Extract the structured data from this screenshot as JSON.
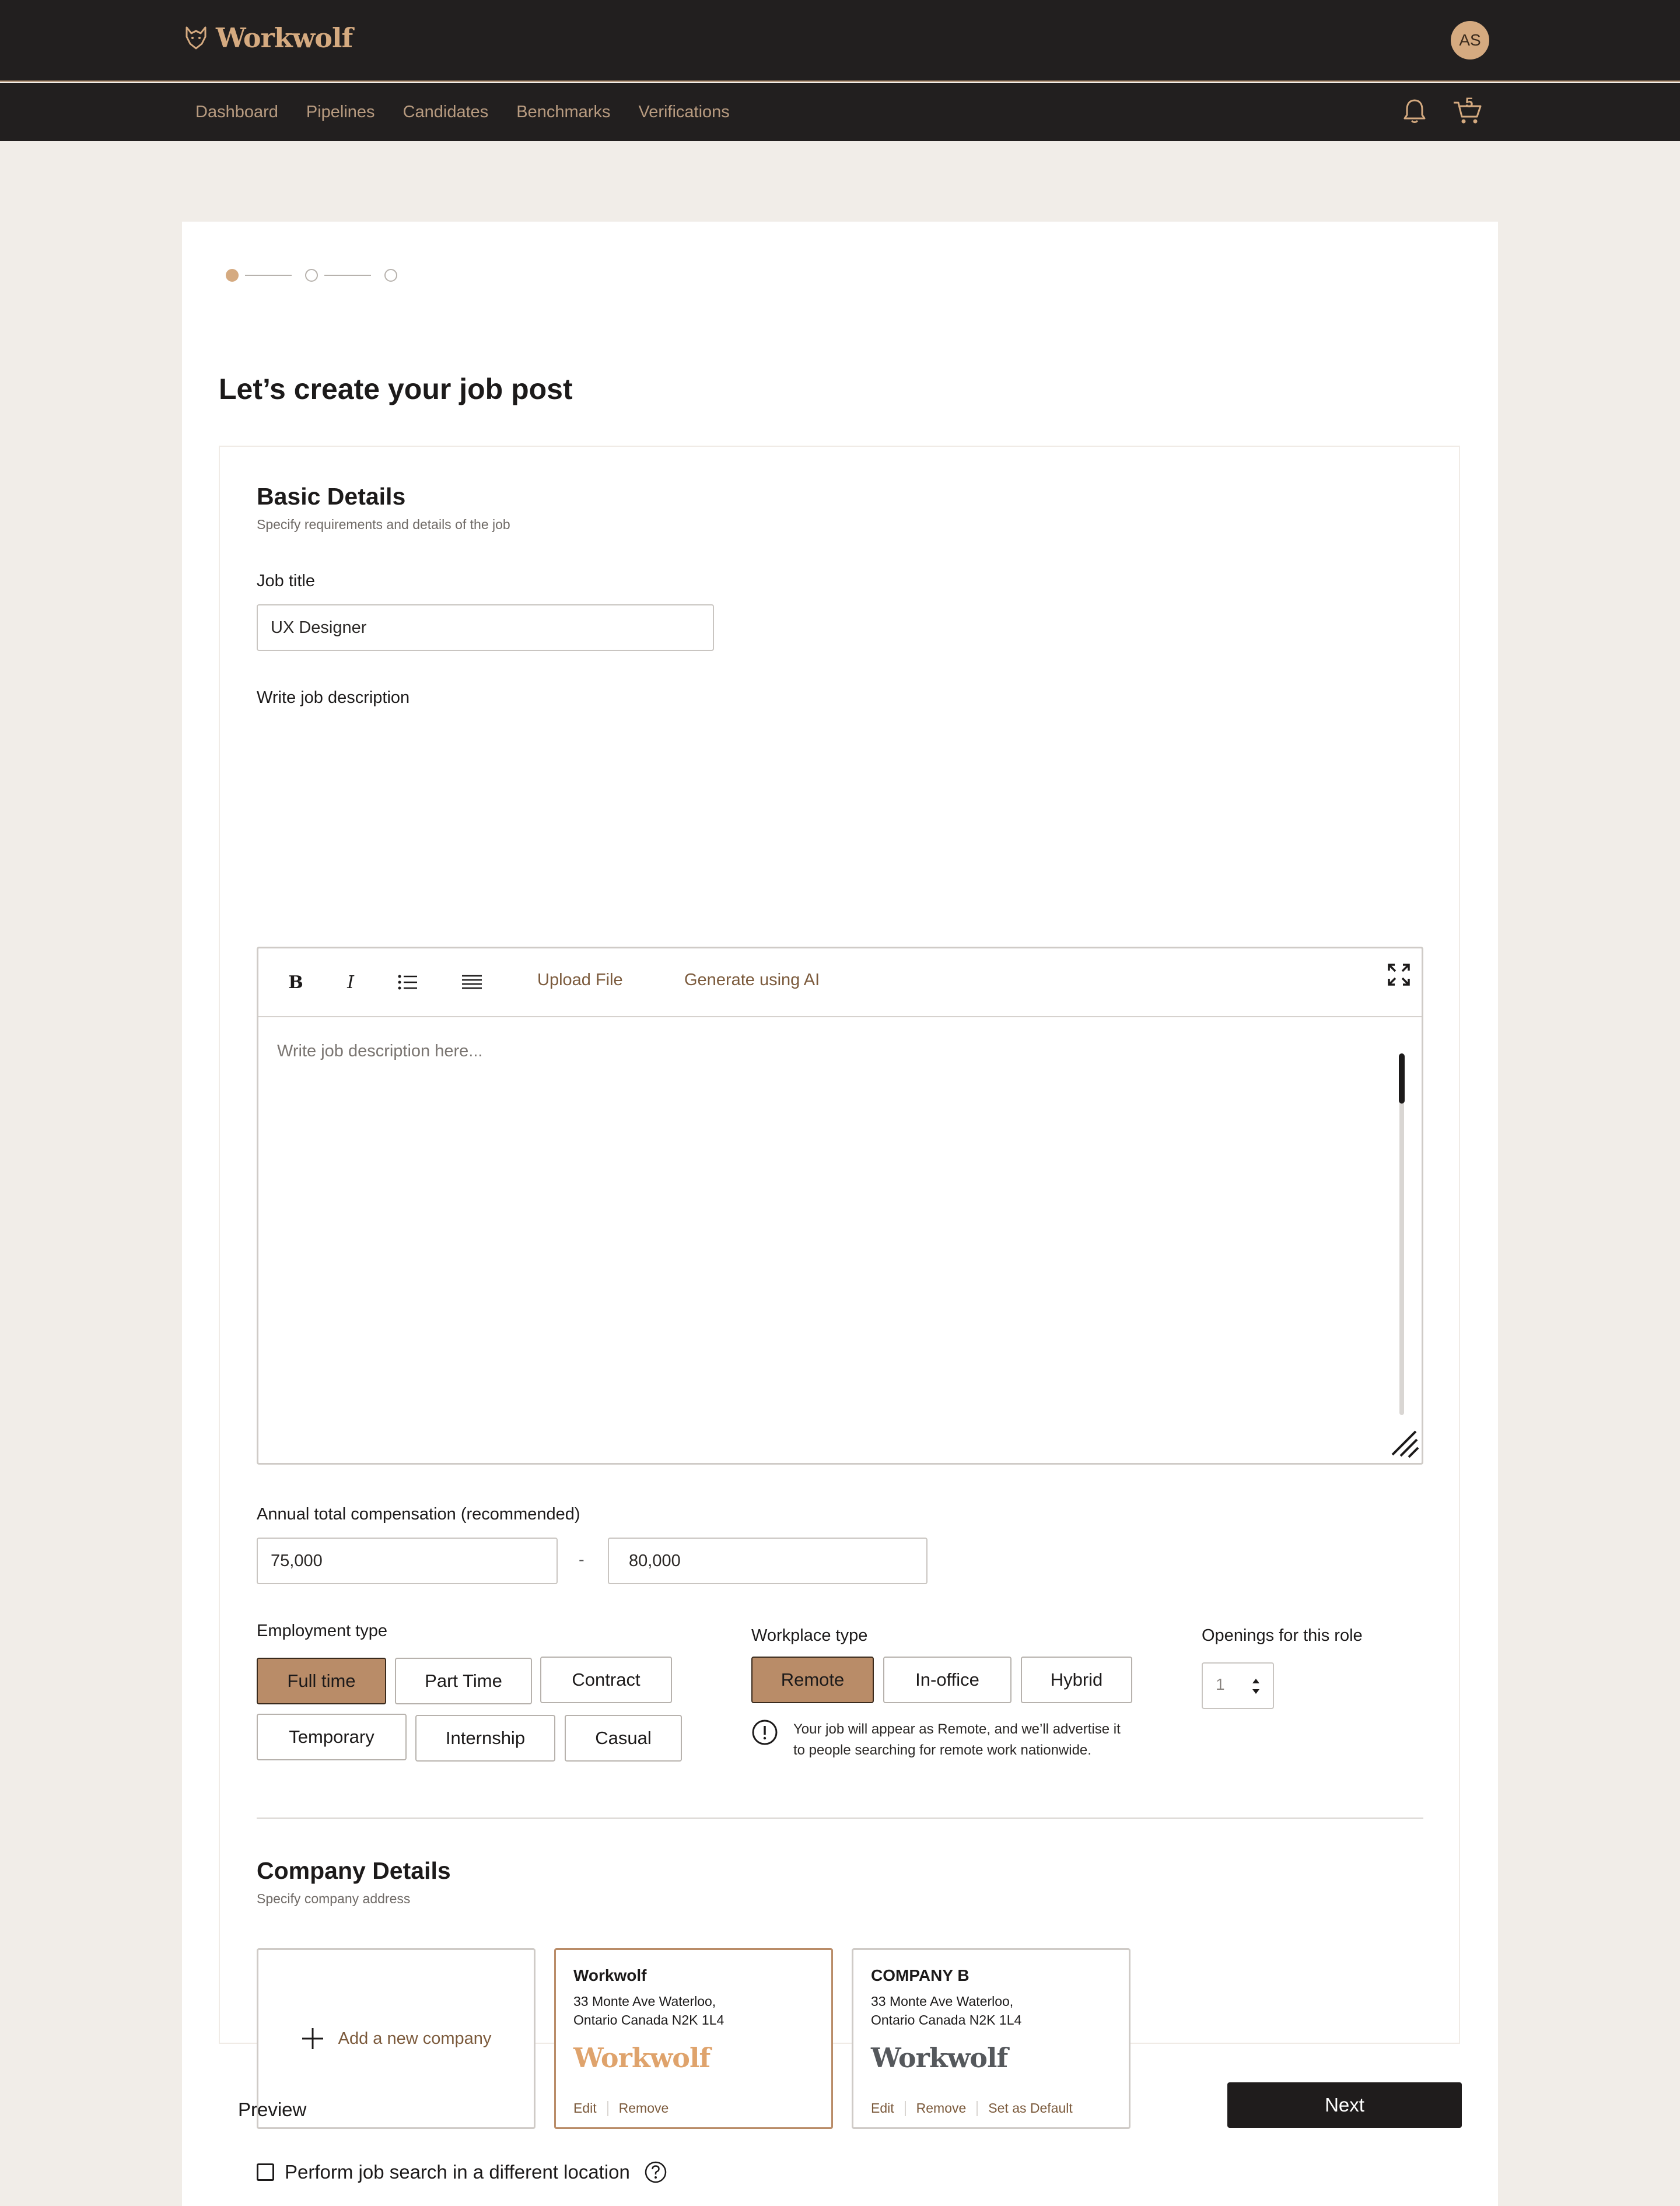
{
  "app": {
    "brand": "Workwolf",
    "avatar_initials": "AS",
    "cart_count": "5"
  },
  "nav": {
    "items": [
      "Dashboard",
      "Pipelines",
      "Candidates",
      "Benchmarks",
      "Verifications"
    ]
  },
  "stepper": {
    "current_step": 1,
    "total_steps": 3
  },
  "page": {
    "title": "Let’s create your job post"
  },
  "basic": {
    "title": "Basic Details",
    "subtitle": "Specify requirements and details of the job",
    "job_title_label": "Job title",
    "job_title_value": "UX Designer",
    "description_label": "Write job description",
    "toolbar": {
      "bold": "B",
      "italic": "I",
      "upload": "Upload File",
      "generate": "Generate using AI"
    },
    "description_placeholder": "Write job description here...",
    "compensation_label": "Annual total compensation (recommended)",
    "comp_min": "75,000",
    "comp_separator": "-",
    "comp_max": "80,000",
    "employment_label": "Employment type",
    "employment_types": [
      "Full time",
      "Part Time",
      "Contract",
      "Temporary",
      "Internship",
      "Casual"
    ],
    "employment_selected": "Full time",
    "workplace_label": "Workplace type",
    "workplace_types": [
      "Remote",
      "In-office",
      "Hybrid"
    ],
    "workplace_selected": "Remote",
    "workplace_info": "Your job will appear as Remote, and we’ll advertise it to people searching for remote work nationwide.",
    "openings_label": "Openings for this role",
    "openings_value": "1"
  },
  "company": {
    "title": "Company Details",
    "subtitle": "Specify company address",
    "add_label": "Add a new company",
    "cards": [
      {
        "name": "Workwolf",
        "address_line1": "33 Monte Ave Waterloo,",
        "address_line2": "Ontario Canada N2K 1L4",
        "logo_text": "Workwolf",
        "logo_color": "#dfa36c",
        "edit": "Edit",
        "remove": "Remove",
        "selected": true
      },
      {
        "name": "COMPANY B",
        "address_line1": "33 Monte Ave Waterloo,",
        "address_line2": "Ontario Canada N2K 1L4",
        "logo_text": "Workwolf",
        "logo_color": "#55585c",
        "edit": "Edit",
        "remove": "Remove",
        "set_default": "Set as Default",
        "selected": false
      }
    ],
    "different_location_label": "Perform job search in a different location"
  },
  "footer": {
    "preview": "Preview",
    "next": "Next"
  },
  "colors": {
    "accent": "#b98c68",
    "brand": "#d5aa80",
    "header_bg": "#221f1f",
    "link": "#7b5a3c"
  }
}
